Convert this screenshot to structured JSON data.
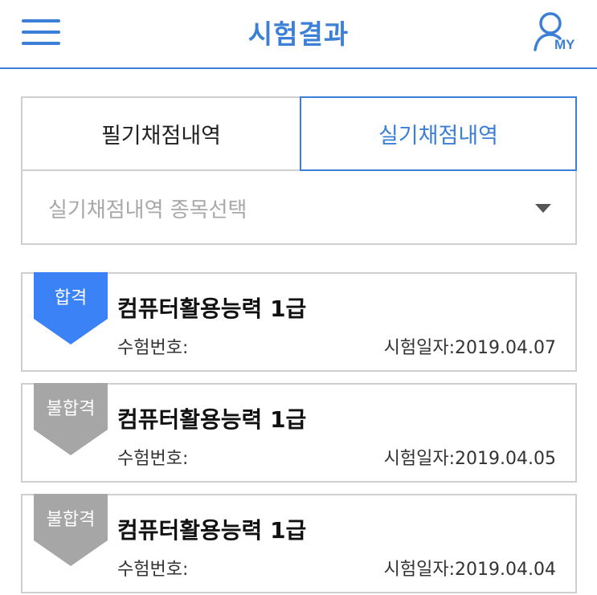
{
  "header": {
    "title": "시험결과",
    "my_label": "MY",
    "accent": "#3b7fd6"
  },
  "tabs": [
    {
      "label": "필기채점내역",
      "active": false
    },
    {
      "label": "실기채점내역",
      "active": true
    }
  ],
  "select": {
    "placeholder": "실기채점내역 종목선택"
  },
  "results": [
    {
      "status": "합격",
      "status_color": "#3b82f6",
      "title": "컴퓨터활용능력 1급",
      "exam_no_label": "수험번호:",
      "date_text": "시험일자:2019.04.07"
    },
    {
      "status": "불합격",
      "status_color": "#a6a6a6",
      "title": "컴퓨터활용능력 1급",
      "exam_no_label": "수험번호:",
      "date_text": "시험일자:2019.04.05"
    },
    {
      "status": "불합격",
      "status_color": "#a6a6a6",
      "title": "컴퓨터활용능력 1급",
      "exam_no_label": "수험번호:",
      "date_text": "시험일자:2019.04.04"
    }
  ]
}
